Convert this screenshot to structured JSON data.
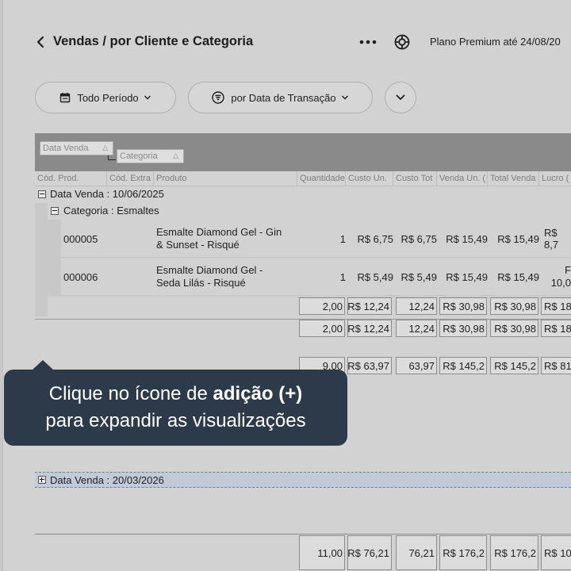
{
  "header": {
    "title": "Vendas / por Cliente e Categoria",
    "plan_text": "Plano Premium até 24/08/20"
  },
  "filters": {
    "period_label": "Todo Período",
    "date_label": "por Data de Transação"
  },
  "grid": {
    "group_chips": [
      "Data Venda",
      "Categoria"
    ],
    "columns": [
      "Cód. Prod.",
      "Cód. Extra",
      "Produto",
      "Quantidade",
      "Custo Un.",
      "Custo Tot",
      "Venda Un. (",
      "Total Venda",
      "Lucro ("
    ],
    "group1": {
      "label": "Data Venda : 10/06/2025"
    },
    "subgroup1": {
      "label": "Categoria : Esmaltes"
    },
    "rows": [
      {
        "code": "000005",
        "product_line1": "Esmalte Diamond Gel - Gin",
        "product_line2": "& Sunset - Risqué",
        "qty": "1",
        "cost_unit": "R$ 6,75",
        "cost_total": "R$ 6,75",
        "sale_unit": "R$ 15,49",
        "sale_total": "R$ 15,49",
        "profit": "R$ 8,7"
      },
      {
        "code": "000006",
        "product_line1": "Esmalte Diamond Gel -",
        "product_line2": "Seda Lilás - Risqué",
        "qty": "1",
        "cost_unit": "R$ 5,49",
        "cost_total": "R$ 5,49",
        "sale_unit": "R$ 15,49",
        "sale_total": "R$ 15,49",
        "profit_line1": "F",
        "profit_line2": "10,0"
      }
    ],
    "subtotal_category": [
      "2,00",
      "R$ 12,24",
      "12,24",
      "R$ 30,98",
      "R$ 30,98",
      "R$ 18"
    ],
    "subtotal_date": [
      "2,00",
      "R$ 12,24",
      "12,24",
      "R$ 30,98",
      "R$ 30,98",
      "R$ 18"
    ],
    "group2": {
      "label": "Data Venda : 20/03/2026"
    },
    "subtotal_group2": [
      "9,00",
      "R$ 63,97",
      "63,97",
      "R$ 145,2",
      "R$ 145,2",
      "R$ 81"
    ],
    "grand_total": [
      "11,00",
      "R$ 76,21",
      "76,21",
      "R$ 176,2",
      "R$ 176,2",
      "R$ 10"
    ]
  },
  "tooltip": {
    "line1_plain": "Clique no ícone de ",
    "line1_bold": "adição (+)",
    "line2": "para expandir as visualizações"
  }
}
